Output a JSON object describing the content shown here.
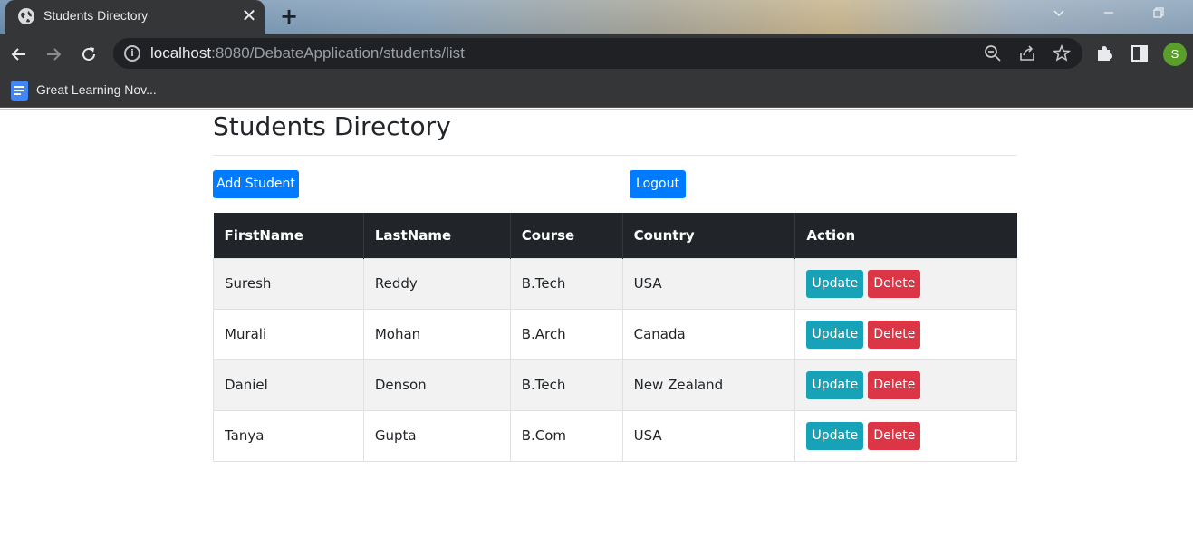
{
  "browser": {
    "tab_title": "Students Directory",
    "tab_close": "✕",
    "new_tab": "+",
    "url_host": "localhost",
    "url_path": ":8080/DebateApplication/students/list",
    "profile_initial": "S",
    "bookmark_label": "Great Learning Nov...",
    "icons": [
      "globe-icon",
      "close-icon",
      "plus-icon",
      "chevron-down-icon",
      "minimize-icon",
      "restore-icon",
      "back-icon",
      "forward-icon",
      "reload-icon",
      "info-icon",
      "zoom-out-icon",
      "share-icon",
      "star-icon",
      "puzzle-icon",
      "sidepanel-icon",
      "docs-icon"
    ]
  },
  "page": {
    "title": "Students Directory",
    "add_button": "Add Student",
    "logout_button": "Logout",
    "colors": {
      "primary": "#007bff",
      "info": "#17a2b8",
      "danger": "#dc3545",
      "header": "#212529"
    }
  },
  "table": {
    "headers": [
      "FirstName",
      "LastName",
      "Course",
      "Country",
      "Action"
    ],
    "rows": [
      {
        "first": "Suresh",
        "last": "Reddy",
        "course": "B.Tech",
        "country": "USA"
      },
      {
        "first": "Murali",
        "last": "Mohan",
        "course": "B.Arch",
        "country": "Canada"
      },
      {
        "first": "Daniel",
        "last": "Denson",
        "course": "B.Tech",
        "country": "New Zealand"
      },
      {
        "first": "Tanya",
        "last": "Gupta",
        "course": "B.Com",
        "country": "USA"
      }
    ],
    "update_label": "Update",
    "delete_label": "Delete"
  }
}
